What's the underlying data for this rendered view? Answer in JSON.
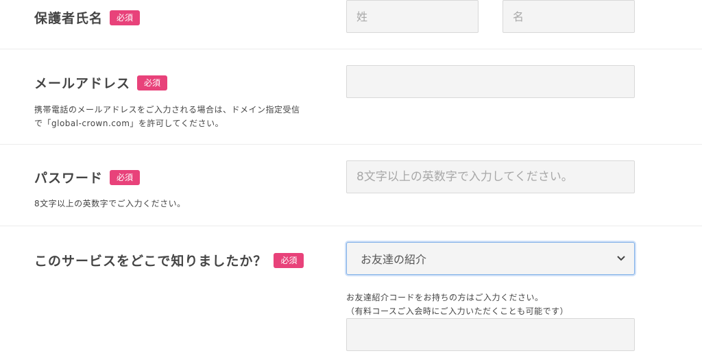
{
  "guardian_name": {
    "label": "保護者氏名",
    "required": "必須",
    "last_name_placeholder": "姓",
    "first_name_placeholder": "名"
  },
  "email": {
    "label": "メールアドレス",
    "required": "必須",
    "note_line1": "携帯電話のメールアドレスをご入力される場合は、ドメイン指定受信",
    "note_line2": "で「global-crown.com」を許可してください。",
    "value": ""
  },
  "password": {
    "label": "パスワード",
    "required": "必須",
    "placeholder": "8文字以上の英数字で入力してください。",
    "note": "8文字以上の英数字でご入力ください。"
  },
  "referral_source": {
    "label": "このサービスをどこで知りましたか？",
    "required": "必須",
    "selected": "お友達の紹介",
    "note_line1": "お友達紹介コードをお持ちの方はご入力ください。",
    "note_line2": "（有料コースご入会時にご入力いただくことも可能です）",
    "code_value": ""
  },
  "icons": {
    "select_arrow": "chevron-down-icon"
  },
  "colors": {
    "required_badge": "#e8427a",
    "select_focus": "#7fb0e8",
    "field_bg": "#f4f4f4"
  }
}
